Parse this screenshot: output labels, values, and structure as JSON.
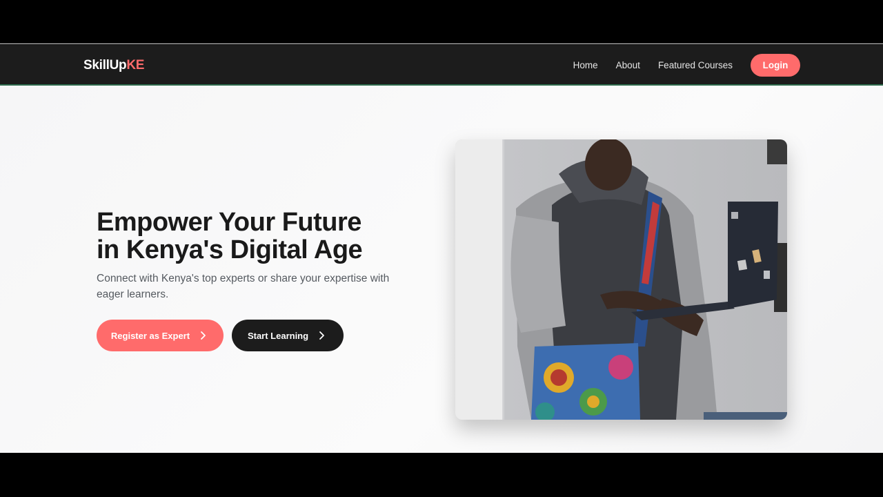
{
  "navbar": {
    "brand_part1": "SkillUp",
    "brand_part2": "KE",
    "links": [
      "Home",
      "About",
      "Featured Courses"
    ],
    "login_label": "Login"
  },
  "hero": {
    "headline_line1": "Empower Your Future",
    "headline_line2": "in Kenya's Digital Age",
    "subtext": "Connect with Kenya's top experts or share your expertise with eager learners.",
    "register_label": "Register as Expert",
    "start_label": "Start Learning"
  },
  "icons": {
    "register_icon": "chevron-right-icon",
    "start_icon": "chevron-right-icon"
  },
  "colors": {
    "accent": "#ff6b6b",
    "navbar_bg": "#1c1c1c",
    "dark_button": "#1c1c1c",
    "hero_bg": "#f7f7f8"
  }
}
